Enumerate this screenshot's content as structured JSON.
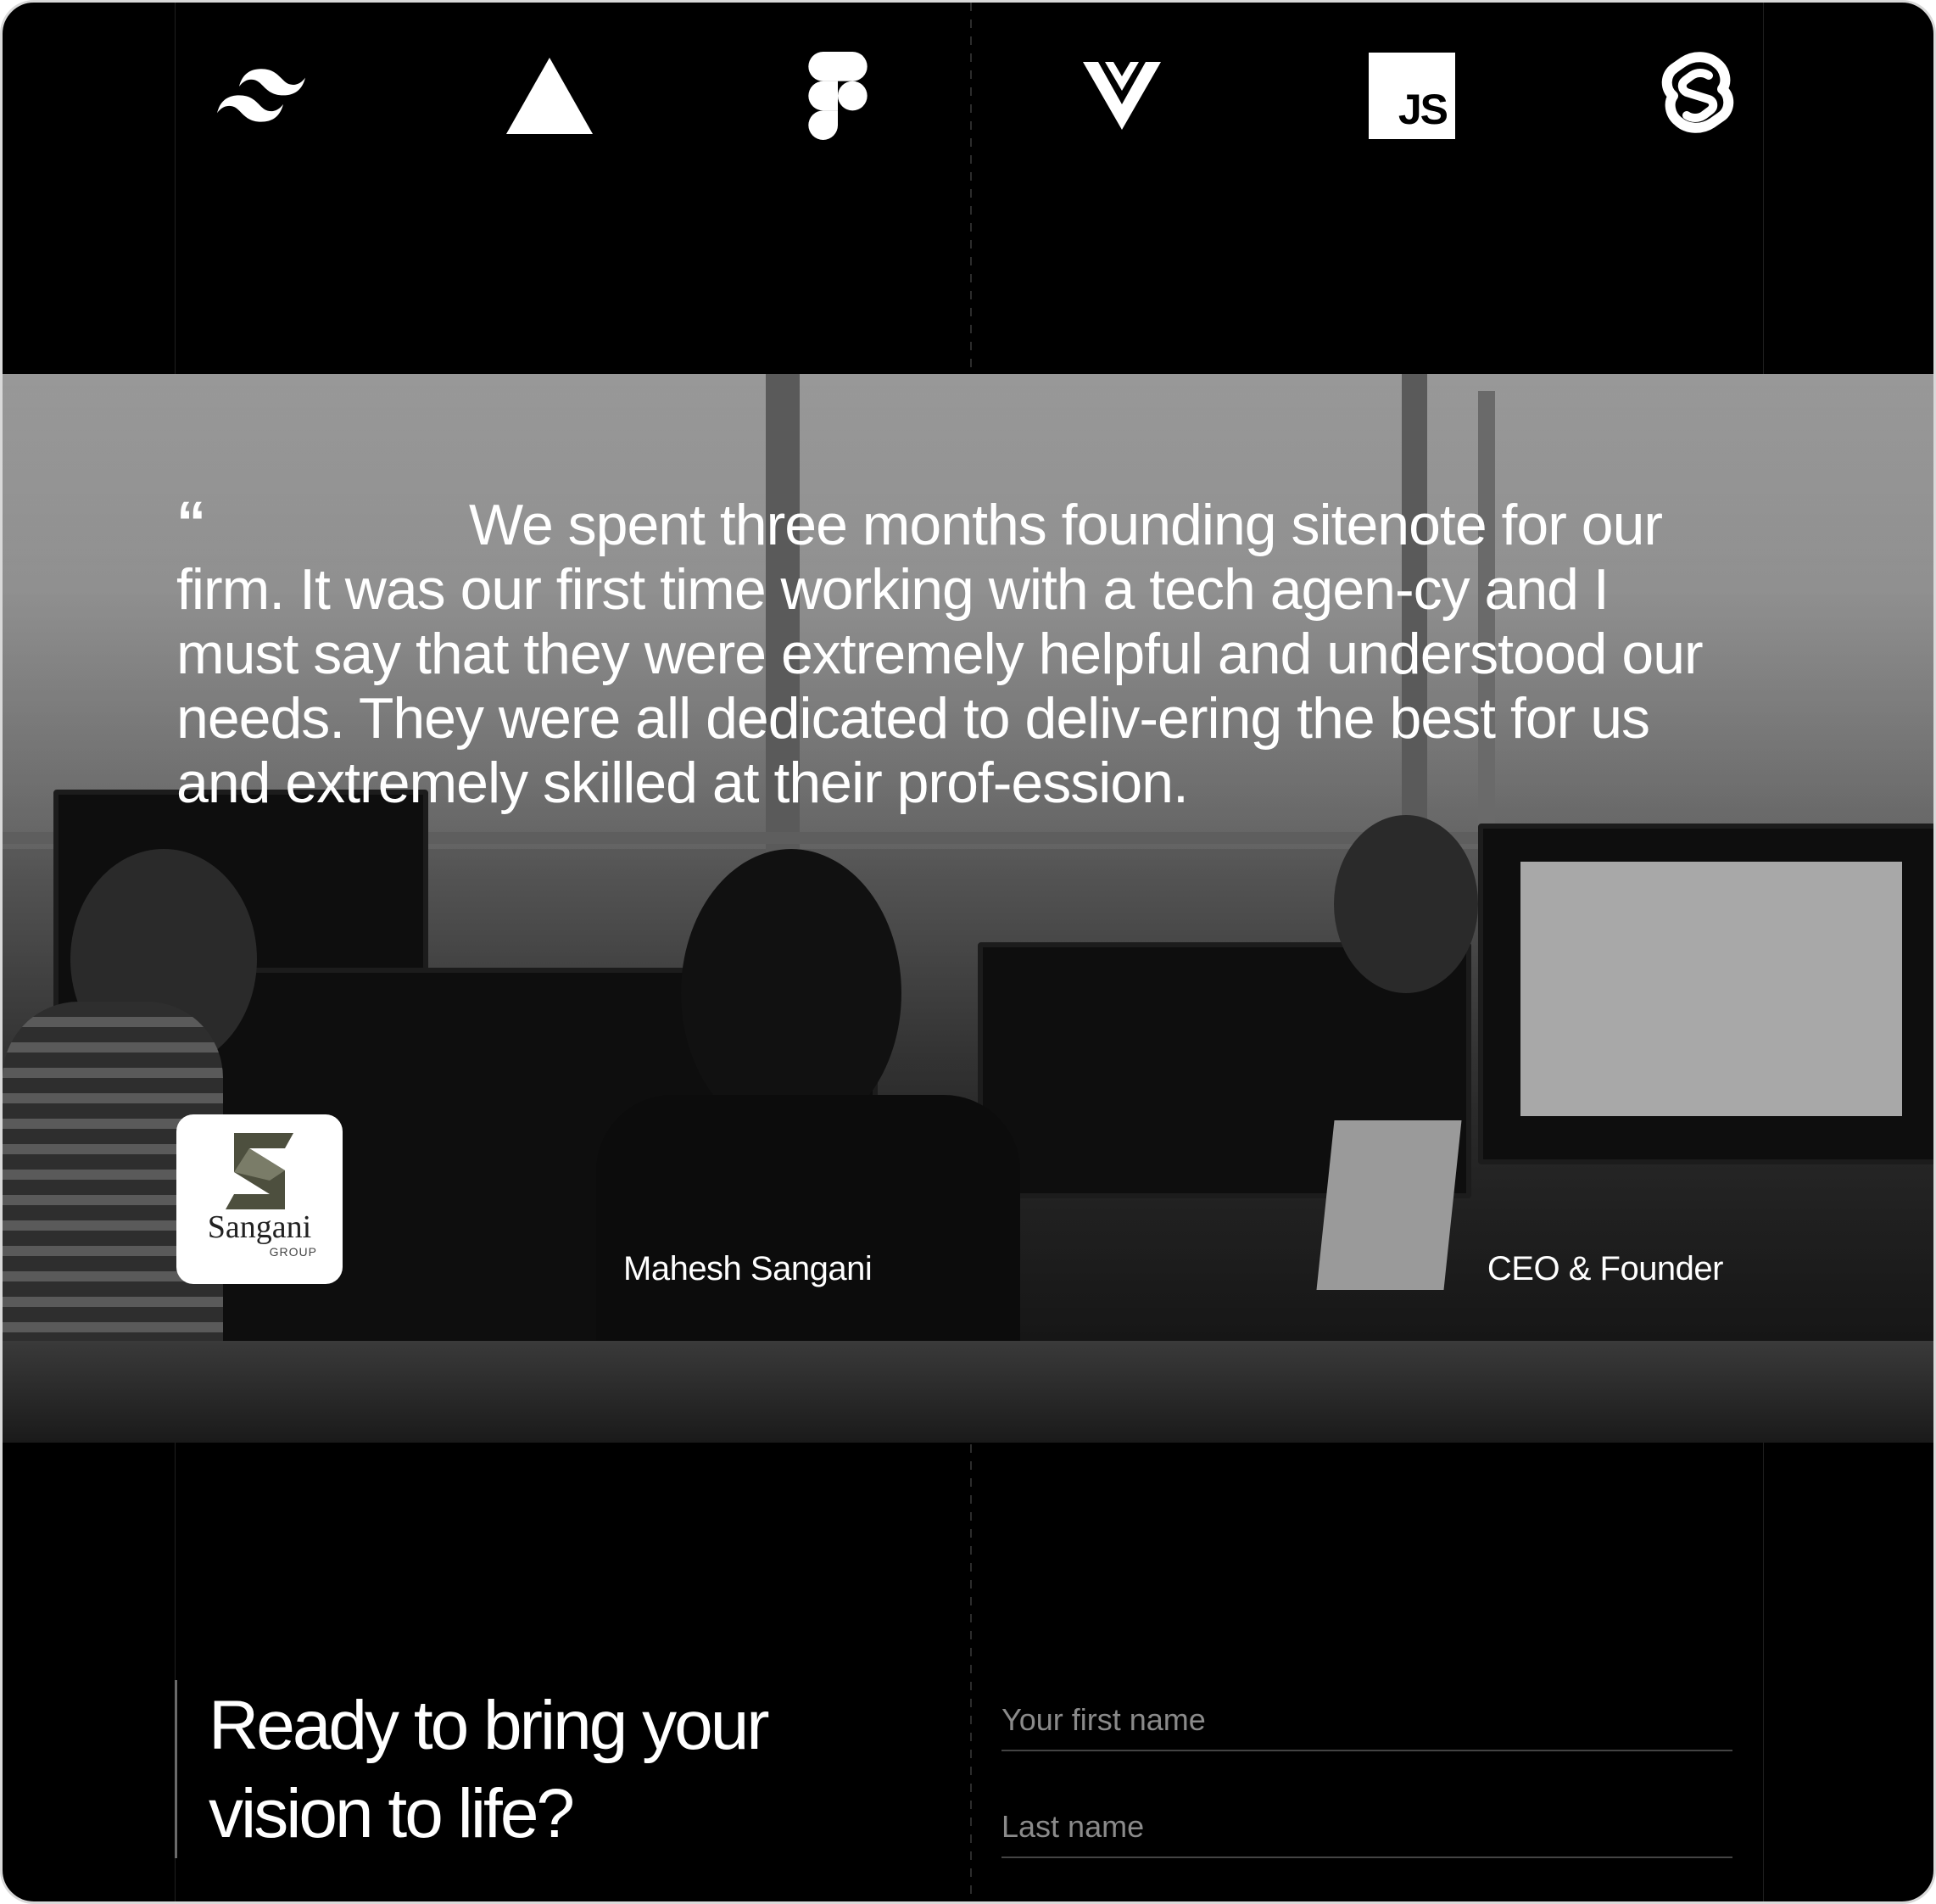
{
  "tech_logos": [
    {
      "name": "tailwind-icon"
    },
    {
      "name": "triangle-icon"
    },
    {
      "name": "figma-icon"
    },
    {
      "name": "vue-icon"
    },
    {
      "name": "javascript-icon",
      "text": "JS"
    },
    {
      "name": "svelte-icon"
    }
  ],
  "testimonial": {
    "quote_mark": "“",
    "quote": "We spent three months founding sitenote for our firm. It was our first time working with a tech agen-cy and I must say that they were extremely helpful and understood our needs. They were all dedicated to deliv-ering the best for us and extremely skilled at their prof-ession.",
    "client_logo_text": "Sangani",
    "client_logo_subtext": "GROUP",
    "person_name": "Mahesh Sangani",
    "person_role": "CEO & Founder"
  },
  "cta": {
    "title_line1": "Ready to bring your",
    "title_line2": "vision to life?",
    "first_name_placeholder": "Your first name",
    "last_name_placeholder": "Last name"
  },
  "colors": {
    "background": "#000000",
    "text": "#ffffff",
    "placeholder": "#8a8a8a"
  }
}
